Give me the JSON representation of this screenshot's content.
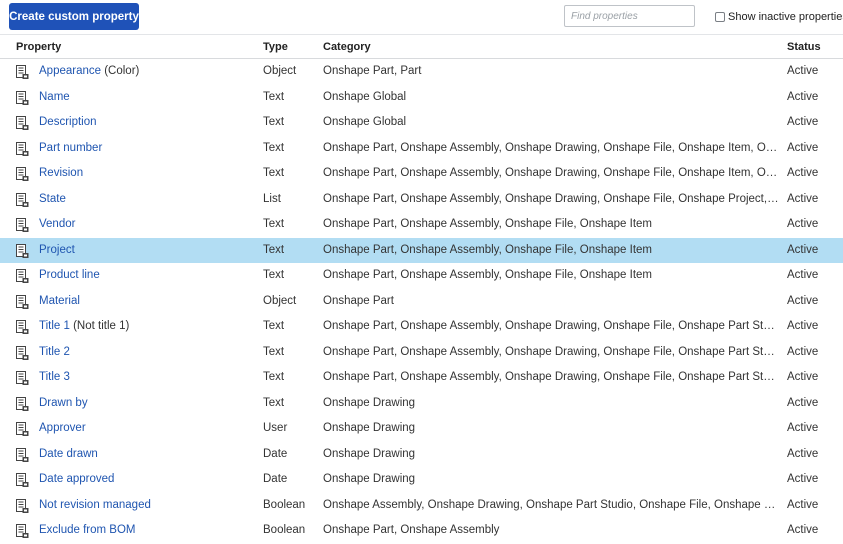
{
  "toolbar": {
    "create_label": "Create custom property",
    "search_placeholder": "Find properties",
    "inactive_label": "Show inactive properties"
  },
  "columns": {
    "property": "Property",
    "type": "Type",
    "category": "Category",
    "status": "Status"
  },
  "rows": [
    {
      "name": "Appearance",
      "suffix": " (Color)",
      "type": "Object",
      "category": "Onshape Part, Part",
      "status": "Active"
    },
    {
      "name": "Name",
      "suffix": "",
      "type": "Text",
      "category": "Onshape Global",
      "status": "Active"
    },
    {
      "name": "Description",
      "suffix": "",
      "type": "Text",
      "category": "Onshape Global",
      "status": "Active"
    },
    {
      "name": "Part number",
      "suffix": "",
      "type": "Text",
      "category": "Onshape Part, Onshape Assembly, Onshape Drawing, Onshape File, Onshape Item, Onshape Appli…",
      "status": "Active"
    },
    {
      "name": "Revision",
      "suffix": "",
      "type": "Text",
      "category": "Onshape Part, Onshape Assembly, Onshape Drawing, Onshape File, Onshape Item, Onshape Appli…",
      "status": "Active"
    },
    {
      "name": "State",
      "suffix": "",
      "type": "List",
      "category": "Onshape Part, Onshape Assembly, Onshape Drawing, Onshape File, Onshape Project, Onshape Ite…",
      "status": "Active"
    },
    {
      "name": "Vendor",
      "suffix": "",
      "type": "Text",
      "category": "Onshape Part, Onshape Assembly, Onshape File, Onshape Item",
      "status": "Active"
    },
    {
      "name": "Project",
      "suffix": "",
      "type": "Text",
      "category": "Onshape Part, Onshape Assembly, Onshape File, Onshape Item",
      "status": "Active",
      "selected": true
    },
    {
      "name": "Product line",
      "suffix": "",
      "type": "Text",
      "category": "Onshape Part, Onshape Assembly, Onshape File, Onshape Item",
      "status": "Active"
    },
    {
      "name": "Material",
      "suffix": "",
      "type": "Object",
      "category": "Onshape Part",
      "status": "Active"
    },
    {
      "name": "Title 1",
      "suffix": " (Not title 1)",
      "type": "Text",
      "category": "Onshape Part, Onshape Assembly, Onshape Drawing, Onshape File, Onshape Part Studio, Part, A…",
      "status": "Active"
    },
    {
      "name": "Title 2",
      "suffix": "",
      "type": "Text",
      "category": "Onshape Part, Onshape Assembly, Onshape Drawing, Onshape File, Onshape Part Studio",
      "status": "Active"
    },
    {
      "name": "Title 3",
      "suffix": "",
      "type": "Text",
      "category": "Onshape Part, Onshape Assembly, Onshape Drawing, Onshape File, Onshape Part Studio",
      "status": "Active"
    },
    {
      "name": "Drawn by",
      "suffix": "",
      "type": "Text",
      "category": "Onshape Drawing",
      "status": "Active"
    },
    {
      "name": "Approver",
      "suffix": "",
      "type": "User",
      "category": "Onshape Drawing",
      "status": "Active"
    },
    {
      "name": "Date drawn",
      "suffix": "",
      "type": "Date",
      "category": "Onshape Drawing",
      "status": "Active"
    },
    {
      "name": "Date approved",
      "suffix": "",
      "type": "Date",
      "category": "Onshape Drawing",
      "status": "Active"
    },
    {
      "name": "Not revision managed",
      "suffix": "",
      "type": "Boolean",
      "category": "Onshape Assembly, Onshape Drawing, Onshape Part Studio, Onshape File, Onshape Part, Onshap…",
      "status": "Active"
    },
    {
      "name": "Exclude from BOM",
      "suffix": "",
      "type": "Boolean",
      "category": "Onshape Part, Onshape Assembly",
      "status": "Active"
    }
  ],
  "icons": {
    "row_icon": "property-document-icon"
  },
  "colors": {
    "accent": "#1f52b8",
    "link": "#1f55b0",
    "selected_row": "#b2ddf3"
  }
}
